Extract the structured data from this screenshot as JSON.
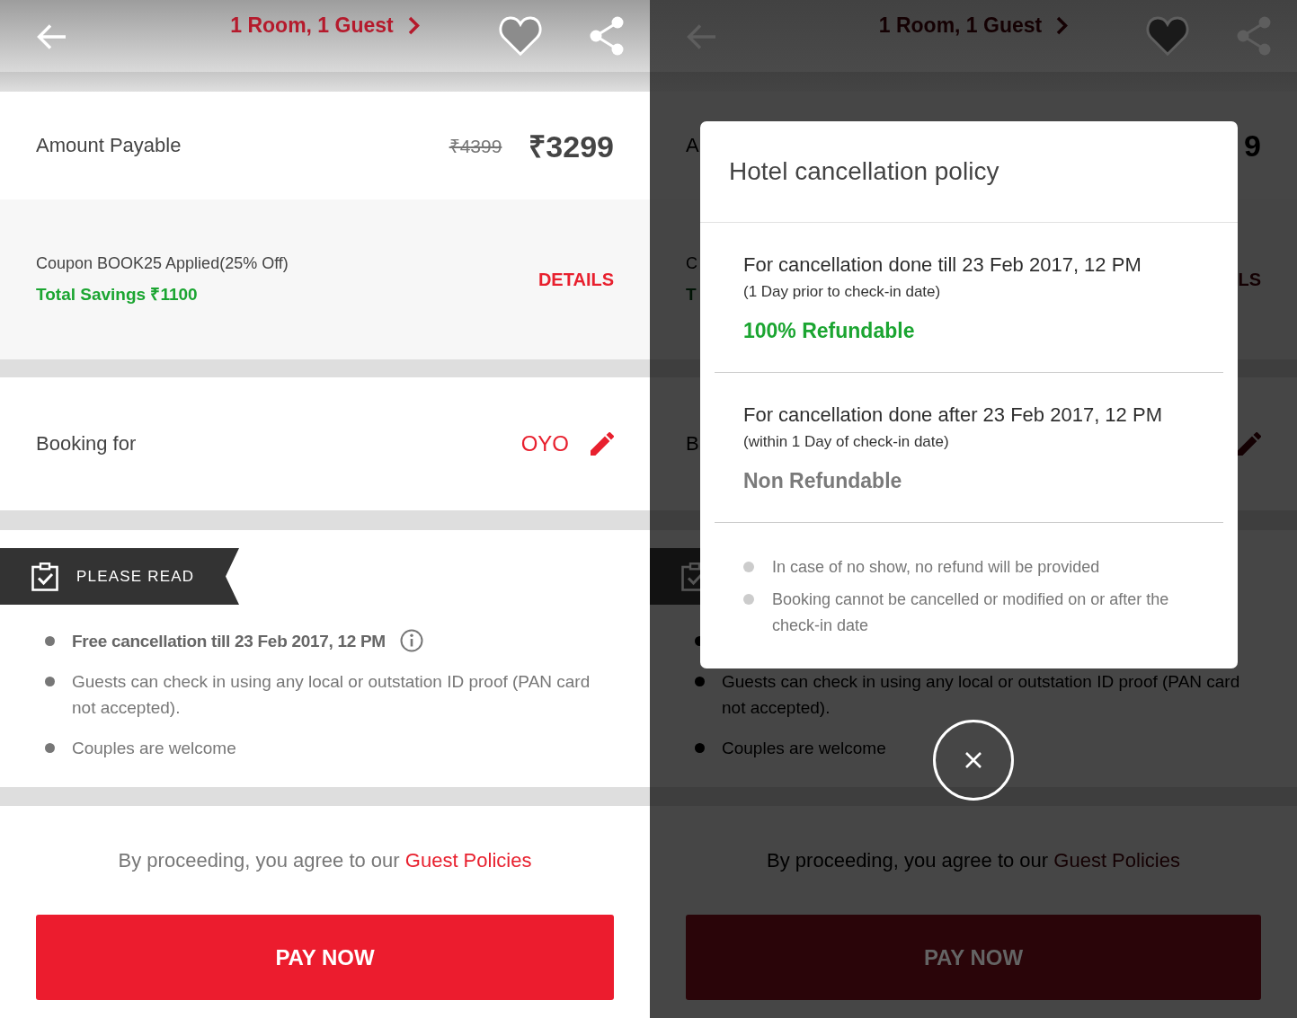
{
  "screens": [
    {
      "dimmed": false,
      "header": {
        "title": "1 Room, 1 Guest"
      },
      "amount": {
        "label": "Amount Payable",
        "original_price": "₹4399",
        "price": "₹3299"
      },
      "coupon": {
        "text": "Coupon BOOK25 Applied(25% Off)",
        "savings": "Total Savings ₹1100",
        "action": "DETAILS"
      },
      "booking": {
        "label": "Booking for",
        "name": "OYO"
      },
      "notice": {
        "banner": "PLEASE READ",
        "items": [
          {
            "kind": "highlight",
            "text": "Free cancellation till 23 Feb 2017, 12 PM"
          },
          {
            "kind": "plain",
            "text": "Guests can check in using any local or outstation ID proof (PAN card not accepted)."
          },
          {
            "kind": "plain",
            "text": "Couples are welcome"
          }
        ]
      },
      "footer": {
        "agreement": "By proceeding, you agree to our",
        "link": "Guest Policies",
        "button": "PAY NOW"
      }
    },
    {
      "dimmed": true,
      "header": {
        "title": "1 Room, 1 Guest"
      },
      "amount": {
        "label": "A",
        "price": "9"
      },
      "coupon": {
        "text": "C",
        "savings": "T",
        "action": "LS"
      },
      "booking": {
        "label": "B"
      },
      "notice": {
        "items": [
          {
            "kind": "highlight"
          },
          {
            "kind": "plain",
            "text": "Guests can check in using any local or outstation ID proof (PAN card not accepted)."
          },
          {
            "kind": "plain",
            "text": "Couples are welcome"
          }
        ]
      },
      "footer": {
        "agreement": "By proceeding, you agree to our",
        "link": "Guest Policies",
        "button": "PAY NOW"
      },
      "dialog": {
        "title": "Hotel cancellation policy",
        "policies": [
          {
            "heading": "For cancellation done till 23 Feb 2017, 12 PM",
            "note": "(1 Day prior to check-in date)",
            "status": "100% Refundable",
            "refundable": true
          },
          {
            "heading": "For cancellation done after 23 Feb 2017, 12 PM",
            "note": "(within 1 Day of check-in date)",
            "status": "Non Refundable",
            "refundable": false
          }
        ],
        "notes": [
          "In case of no show, no refund will be provided",
          "Booking cannot be cancelled or modified on or after the check-in date"
        ]
      }
    }
  ]
}
